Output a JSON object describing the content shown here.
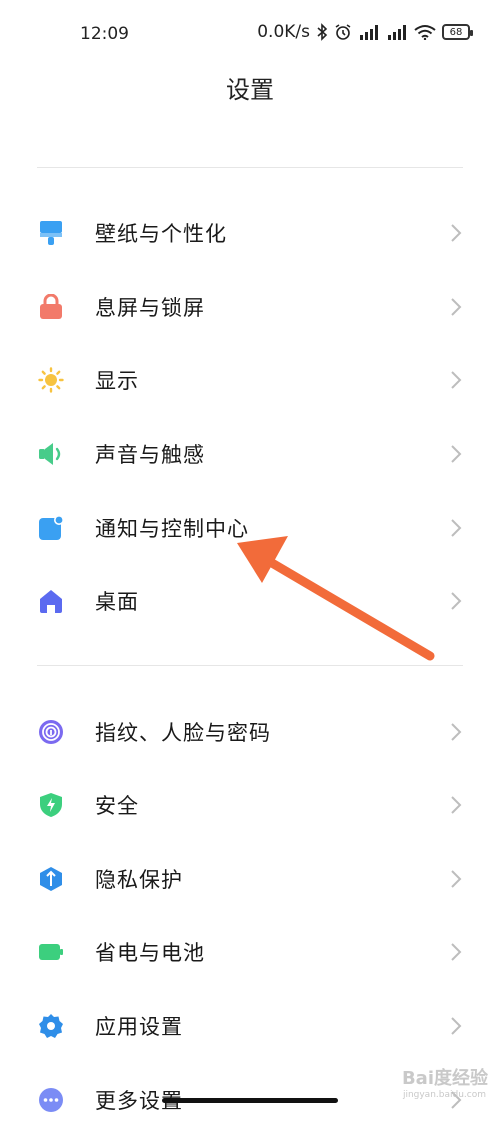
{
  "status_bar": {
    "time": "12:09",
    "net_speed": "0.0K/s",
    "battery": "68"
  },
  "header": {
    "title": "设置"
  },
  "settings": {
    "group1": [
      {
        "label": "壁纸与个性化",
        "icon": "brush-icon",
        "color": "#3aa0f2"
      },
      {
        "label": "息屏与锁屏",
        "icon": "lock-icon",
        "color": "#f27a6a"
      },
      {
        "label": "显示",
        "icon": "sun-icon",
        "color": "#f7c340"
      },
      {
        "label": "声音与触感",
        "icon": "speaker-icon",
        "color": "#47cc8a"
      },
      {
        "label": "通知与控制中心",
        "icon": "notification-icon",
        "color": "#3aa0f2"
      },
      {
        "label": "桌面",
        "icon": "home-icon",
        "color": "#5b6af0"
      }
    ],
    "group2": [
      {
        "label": "指纹、人脸与密码",
        "icon": "fingerprint-icon",
        "color": "#7b6af0"
      },
      {
        "label": "安全",
        "icon": "shield-icon",
        "color": "#3ccf7e"
      },
      {
        "label": "隐私保护",
        "icon": "privacy-icon",
        "color": "#2f8ee8"
      },
      {
        "label": "省电与电池",
        "icon": "battery-icon",
        "color": "#3ccf7e"
      },
      {
        "label": "应用设置",
        "icon": "gear-icon",
        "color": "#2f8ee8"
      },
      {
        "label": "更多设置",
        "icon": "more-icon",
        "color": "#7b8cf5"
      }
    ]
  },
  "annotation": {
    "arrow_color": "#f26b3a"
  },
  "watermark": {
    "main": "Bai度经验",
    "sub": "jingyan.baidu.com"
  }
}
